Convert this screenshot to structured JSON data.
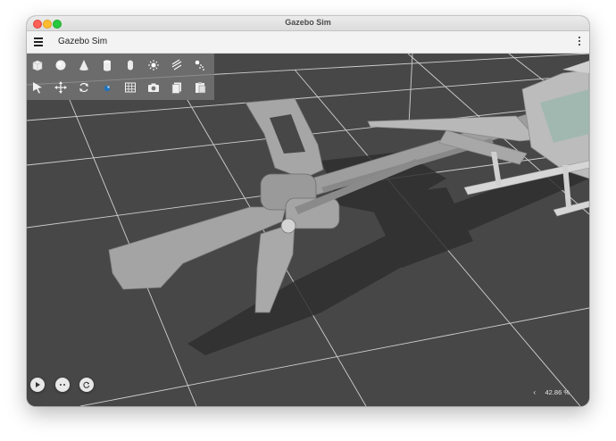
{
  "window": {
    "title": "Gazebo Sim"
  },
  "appbar": {
    "title": "Gazebo Sim"
  },
  "toolbar": {
    "row1": [
      "box-shape",
      "sphere-shape",
      "cone-shape",
      "cylinder-shape",
      "capsule-shape",
      "point-light",
      "directional-light",
      "spot-light"
    ],
    "row2": [
      "select-tool",
      "translate-tool",
      "rotate-tool",
      "transform-control",
      "grid-view",
      "screenshot",
      "copy",
      "paste"
    ]
  },
  "playback": {
    "buttons": [
      "play",
      "step",
      "reset"
    ]
  },
  "status": {
    "real_time_factor": "42.86 %",
    "expand_glyph": "‹"
  },
  "colors": {
    "scene_bg": "#474747",
    "grid_line": "#d8d8d8",
    "model": "#a9a9a9",
    "accent_blue": "#1e73be"
  }
}
